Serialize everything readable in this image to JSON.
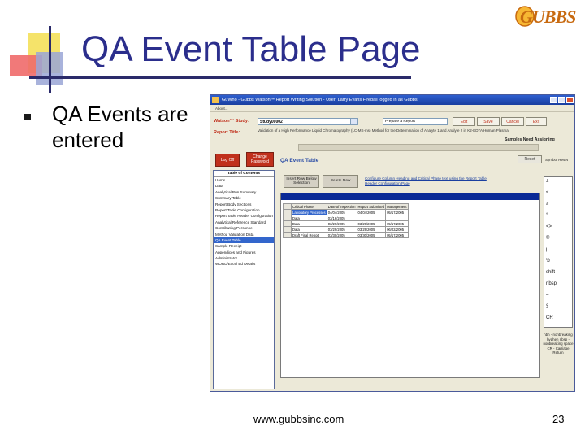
{
  "slide": {
    "title": "QA Event Table Page",
    "bullet": "QA Events are entered",
    "footer_url": "www.gubbsinc.com",
    "page_number": "23",
    "logo_text": "GUBBS"
  },
  "app": {
    "window_title": "GuWho - Gubbs Watson™ Report Writing Solution - User: Larry Evans Fireball logged in as Gubbs",
    "menu": "About...",
    "study_label": "Watson™ Study:",
    "study_value": "Study00002",
    "report_title_label": "Report Title:",
    "report_title_text": "Validation of a High Performance Liquid Chromatography (LC-MS-ms) Method for the Determination of Analyte 1 and Analyte 2 in K2-EDTA Human Plasma",
    "status_value": "Prepare a Report",
    "buttons": {
      "edit": "Edit",
      "save": "Save",
      "cancel": "Cancel",
      "exit": "Exit",
      "log_off": "Log Off",
      "change_password": "Change Password",
      "reset": "Reset",
      "insert_row": "Insert Row Below Selection",
      "delete_row": "Delete Row"
    },
    "sample_need": "Samples Need Assigning",
    "qa_title": "QA Event Table",
    "reset_side_label": "Symbol Reset",
    "config_link": "Configure Column Heading and Critical Phase text using the Report Table Header Configuration Page",
    "toc": {
      "header": "Table of Contents",
      "items": [
        "Home",
        "Data",
        "Analytical Run Summary",
        "Summary Table",
        "Report Body Sections",
        "Report Table Configuration",
        "Report Table Header Configuration",
        "Analytical Reference Standard",
        "Contributing Personnel",
        "Method Validation Data",
        "QA Event Table",
        "Sample Receipt",
        "Appendices and Figures",
        "Administrator",
        "WORD/Excel Ed Details"
      ],
      "selected_index": 10
    },
    "table": {
      "columns": [
        "Critical Phase",
        "Date of Inspection",
        "Report Submitted",
        "Management"
      ],
      "rows": [
        [
          "Laboratory Processes",
          "04/04/2005",
          "04/04/2005",
          "05/17/2005"
        ],
        [
          "Data",
          "03/16/2005",
          "",
          ""
        ],
        [
          "Data",
          "03/29/2005",
          "03/29/2005",
          "05/17/2005"
        ],
        [
          "Data",
          "03/29/2005",
          "03/29/2005",
          "06/02/2005"
        ],
        [
          "Draft Final Report",
          "03/30/2005",
          "03/30/2005",
          "05/17/2005"
        ]
      ],
      "highlighted_row": 0
    },
    "side_symbols": [
      "±",
      "≤",
      "≥",
      "°",
      "<>",
      "®",
      "μ",
      "½",
      "shift",
      "nbsp",
      "–",
      "§",
      "CR"
    ],
    "side_notes": "nbh - nonbreaking hyphen nbsp - nonbreaking space CR - Carriage Return"
  },
  "colors": {
    "title_blue": "#2b2e8c",
    "app_red": "#c0301c",
    "selection_blue": "#3366cc",
    "bar_navy": "#0a2a96"
  }
}
